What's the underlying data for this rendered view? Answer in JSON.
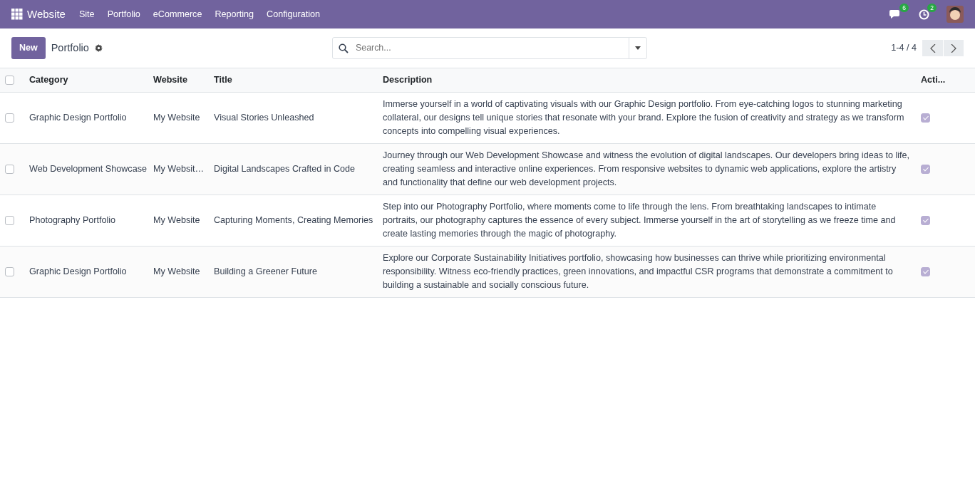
{
  "navbar": {
    "app": "Website",
    "menu": [
      "Site",
      "Portfolio",
      "eCommerce",
      "Reporting",
      "Configuration"
    ],
    "messages_count": "6",
    "activities_count": "2"
  },
  "control_panel": {
    "new_button": "New",
    "breadcrumb": "Portfolio",
    "search": {
      "placeholder": "Search..."
    },
    "pager": "1-4 / 4"
  },
  "table": {
    "select_all": {
      "checked": false
    },
    "columns": [
      "Category",
      "Website",
      "Title",
      "Description",
      "Acti..."
    ],
    "rows": [
      {
        "selected": false,
        "category": "Graphic Design Portfolio",
        "website": "My Website",
        "title": "Visual Stories Unleashed",
        "description": "Immerse yourself in a world of captivating visuals with our Graphic Design portfolio. From eye-catching logos to stunning marketing collateral, our designs tell unique stories that resonate with your brand. Explore the fusion of creativity and strategy as we transform concepts into compelling visual experiences.",
        "active": true
      },
      {
        "selected": false,
        "category": "Web Development Showcase",
        "website": "My Websit…",
        "title": "Digital Landscapes Crafted in Code",
        "description": "Journey through our Web Development Showcase and witness the evolution of digital landscapes. Our developers bring ideas to life, creating seamless and interactive online experiences. From responsive websites to dynamic web applications, explore the artistry and functionality that define our web development projects.",
        "active": true
      },
      {
        "selected": false,
        "category": "Photography Portfolio",
        "website": "My Website",
        "title": "Capturing Moments, Creating Memories",
        "description": "Step into our Photography Portfolio, where moments come to life through the lens. From breathtaking landscapes to intimate portraits, our photography captures the essence of every subject. Immerse yourself in the art of storytelling as we freeze time and create lasting memories through the magic of photography.",
        "active": true
      },
      {
        "selected": false,
        "category": "Graphic Design Portfolio",
        "website": "My Website",
        "title": "Building a Greener Future",
        "description": "Explore our Corporate Sustainability Initiatives portfolio, showcasing how businesses can thrive while prioritizing environmental responsibility. Witness eco-friendly practices, green innovations, and impactful CSR programs that demonstrate a commitment to building a sustainable and socially conscious future.",
        "active": true
      }
    ]
  }
}
